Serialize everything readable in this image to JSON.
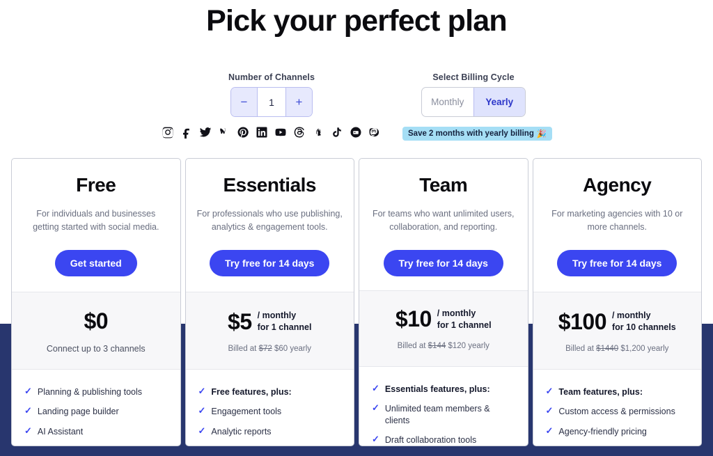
{
  "header": {
    "title": "Pick your perfect plan"
  },
  "controls": {
    "channels": {
      "label": "Number of Channels",
      "decrement": "−",
      "increment": "+",
      "value": "1"
    },
    "billing": {
      "label": "Select Billing Cycle",
      "options": [
        {
          "label": "Monthly",
          "selected": false
        },
        {
          "label": "Yearly",
          "selected": true
        }
      ]
    },
    "save_badge": {
      "text": "Save 2 months with yearly billing",
      "emoji": "🎉"
    }
  },
  "socials": [
    "instagram-icon",
    "facebook-icon",
    "twitter-icon",
    "bluesky-icon",
    "pinterest-icon",
    "linkedin-icon",
    "youtube-icon",
    "threads-icon",
    "shopify-icon",
    "tiktok-icon",
    "google-business-icon",
    "mastodon-icon"
  ],
  "colors": {
    "accent": "#3b46f1",
    "navy_band": "#28366e",
    "badge": "#a5def5",
    "segment_active": "#dfe3fd"
  },
  "plans": [
    {
      "name": "Free",
      "description": "For individuals and businesses getting started with social media.",
      "cta": "Get started",
      "price_amount": "$0",
      "price_unit_line1": "",
      "price_unit_line2": "",
      "price_sub": "Connect up to 3 channels",
      "billed_prefix": "",
      "billed_strike": "",
      "billed_new": "",
      "billed_suffix": "",
      "features": [
        {
          "text": "Planning & publishing tools",
          "bold": false
        },
        {
          "text": "Landing page builder",
          "bold": false
        },
        {
          "text": "AI Assistant",
          "bold": false
        }
      ]
    },
    {
      "name": "Essentials",
      "description": "For professionals who use publishing, analytics & engagement tools.",
      "cta": "Try free for 14 days",
      "price_amount": "$5",
      "price_unit_line1": "/ monthly",
      "price_unit_line2": "for 1 channel",
      "price_sub": "",
      "billed_prefix": "Billed at ",
      "billed_strike": "$72",
      "billed_new": "$60",
      "billed_suffix": " yearly",
      "features": [
        {
          "text": "Free features, plus:",
          "bold": true
        },
        {
          "text": "Engagement tools",
          "bold": false
        },
        {
          "text": "Analytic reports",
          "bold": false
        }
      ]
    },
    {
      "name": "Team",
      "description": "For teams who want unlimited users, collaboration, and reporting.",
      "cta": "Try free for 14 days",
      "price_amount": "$10",
      "price_unit_line1": "/ monthly",
      "price_unit_line2": "for 1 channel",
      "price_sub": "",
      "billed_prefix": "Billed at ",
      "billed_strike": "$144",
      "billed_new": "$120",
      "billed_suffix": " yearly",
      "features": [
        {
          "text": "Essentials features, plus:",
          "bold": true
        },
        {
          "text": "Unlimited team members & clients",
          "bold": false
        },
        {
          "text": "Draft collaboration tools",
          "bold": false
        }
      ]
    },
    {
      "name": "Agency",
      "description": "For marketing agencies with 10 or more channels.",
      "cta": "Try free for 14 days",
      "price_amount": "$100",
      "price_unit_line1": "/ monthly",
      "price_unit_line2": "for 10 channels",
      "price_sub": "",
      "billed_prefix": "Billed at ",
      "billed_strike": "$1440",
      "billed_new": "$1,200",
      "billed_suffix": " yearly",
      "features": [
        {
          "text": "Team features, plus:",
          "bold": true
        },
        {
          "text": "Custom access & permissions",
          "bold": false
        },
        {
          "text": "Agency-friendly pricing",
          "bold": false
        }
      ]
    }
  ]
}
